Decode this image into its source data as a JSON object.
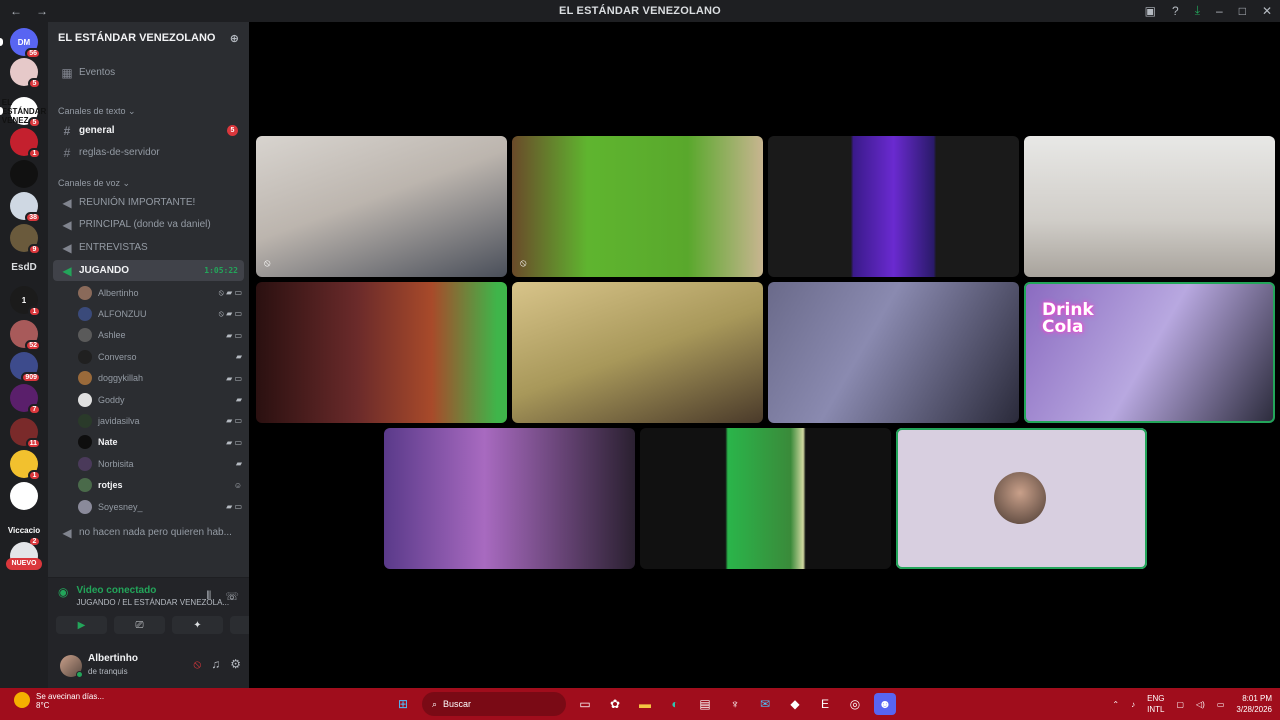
{
  "window": {
    "title": "EL ESTÁNDAR VENEZOLANO",
    "back": "←",
    "forward": "→"
  },
  "servers": {
    "items": [
      {
        "badge": "56",
        "color": "#5865f2",
        "label": "DM"
      },
      {
        "badge": "5",
        "color": "#e6c9c9",
        "label": ""
      },
      {
        "badge": "5",
        "color": "#ffffff",
        "label": "EL ESTÁNDAR VENEZ"
      },
      {
        "badge": "1",
        "color": "#c4202e",
        "label": ""
      },
      {
        "badge": "",
        "color": "#111111",
        "label": ""
      },
      {
        "badge": "38",
        "color": "#cfd8e3",
        "label": ""
      },
      {
        "badge": "9",
        "color": "#6a5a3c",
        "label": ""
      },
      {
        "badge": "1",
        "color": "#1b1b1b",
        "label": "1"
      },
      {
        "badge": "52",
        "color": "#a85a5a",
        "label": ""
      },
      {
        "badge": "909",
        "color": "#3d4b8c",
        "label": ""
      },
      {
        "badge": "7",
        "color": "#5a1f6b",
        "label": ""
      },
      {
        "badge": "11",
        "color": "#7a2a2a",
        "label": ""
      },
      {
        "badge": "1",
        "color": "#f2c12e",
        "label": ""
      },
      {
        "badge": "",
        "color": "#ffffff",
        "label": ""
      },
      {
        "badge": "2",
        "color": "#1e1f22",
        "label": "Viccacio"
      },
      {
        "badge": "",
        "color": "#e3e5e8",
        "label": ""
      }
    ],
    "text_item": "EsdD",
    "nuevo": "NUEVO"
  },
  "sidebar": {
    "server_name": "EL ESTÁNDAR VENEZOLANO",
    "events": "Eventos",
    "text_category": "Canales de texto",
    "text_channels": [
      {
        "name": "general",
        "badge": "5"
      },
      {
        "name": "reglas-de-servidor",
        "badge": ""
      }
    ],
    "voice_category": "Canales de voz",
    "voice_channels": [
      "REUNIÓN IMPORTANTE!",
      "PRINCIPAL (donde va daniel)",
      "ENTREVISTAS"
    ],
    "active_voice": {
      "name": "JUGANDO",
      "timer": "1:05:22"
    },
    "voice_users": [
      {
        "name": "Albertinho",
        "icons": "⦸ ▰ ▭",
        "bold": false,
        "color": "#8a6a5a"
      },
      {
        "name": "ALFONZUU",
        "icons": "⦸ ▰ ▭",
        "bold": false,
        "color": "#3a4a7a"
      },
      {
        "name": "Ashlee",
        "icons": "▰ ▭",
        "bold": false,
        "color": "#5a5a5a"
      },
      {
        "name": "Converso",
        "icons": "▰",
        "bold": false,
        "color": "#202020"
      },
      {
        "name": "doggykillah",
        "icons": "▰ ▭",
        "bold": false,
        "color": "#9a6a3a"
      },
      {
        "name": "Goddy",
        "icons": "▰",
        "bold": false,
        "color": "#e0e0e0"
      },
      {
        "name": "javidasilva",
        "icons": "▰ ▭",
        "bold": false,
        "color": "#2a3a2a"
      },
      {
        "name": "Nate",
        "icons": "▰ ▭",
        "bold": true,
        "color": "#0e0e0e"
      },
      {
        "name": "Norbisita",
        "icons": "▰",
        "bold": false,
        "color": "#4a3a5a"
      },
      {
        "name": "rotjes",
        "icons": "☺",
        "bold": true,
        "color": "#4a6a4a"
      },
      {
        "name": "Soyesney_",
        "icons": "▰ ▭",
        "bold": false,
        "color": "#8a8a9a"
      }
    ],
    "extra_channel": "no hacen nada pero quieren hab..."
  },
  "voice_panel": {
    "status": "Video conectado",
    "location": "JUGANDO / EL ESTÁNDAR VENEZOLA...",
    "buttons": [
      "▶",
      "⎚",
      "✦",
      "✧"
    ]
  },
  "user_panel": {
    "name": "Albertinho",
    "status": "de tranquis",
    "mute_icon": "⦸",
    "headset_icon": "♫",
    "settings_icon": "⚙"
  },
  "stage": {
    "tiles": [
      {
        "name": "tile-1",
        "bg": "linear-gradient(160deg,#d8d4cf 0%,#bcb5ae 45%,#4a4f5a 100%)",
        "muted": true
      },
      {
        "name": "tile-2",
        "bg": "linear-gradient(90deg,#6a4a2a 0%,#5fb52f 30%,#59a82c 70%,#c8b590 100%)",
        "muted": true
      },
      {
        "name": "tile-3",
        "bg": "linear-gradient(90deg,#1a1a1a 0%,#1a1a1a 33%,#3a1a8a 34%,#6a2ad0 50%,#2a1a6a 66%,#1a1a1a 67%,#1a1a1a 100%)",
        "muted": false
      },
      {
        "name": "tile-4",
        "bg": "linear-gradient(180deg,#e8e8e6 0%,#d0cdc8 60%,#a8a39c 100%)",
        "muted": false
      },
      {
        "name": "tile-5",
        "bg": "linear-gradient(90deg,#2a1010 0%,#6a2a2a 40%,#a84a2a 70%,#3fb54a 96%,#3fb54a 100%)",
        "muted": false
      },
      {
        "name": "tile-6",
        "bg": "linear-gradient(160deg,#d8c48a 0%,#a8985a 50%,#4a3a2a 100%)",
        "muted": false
      },
      {
        "name": "tile-7",
        "bg": "linear-gradient(120deg,#6a6a8a 0%,#8a8ab0 40%,#2a2a3a 100%)",
        "muted": false
      },
      {
        "name": "tile-8",
        "bg": "linear-gradient(120deg,#8a6ac0 0%,#b8a8e0 50%,#2a2a3a 100%)",
        "muted": false
      },
      {
        "name": "tile-9",
        "bg": "linear-gradient(90deg,#5a3a8a 0%,#a86ac0 40%,#2a2030 100%)",
        "muted": false
      },
      {
        "name": "tile-10",
        "bg": "linear-gradient(90deg,#111 0%,#111 34%,#2ab54a 35%,#3a8a3a 60%,#d0d8a0 65%,#111 66%,#111 100%)",
        "muted": false
      },
      {
        "name": "tile-11",
        "bg": "#d8cfe0",
        "muted": false
      }
    ],
    "overlay_text": "Drink Cola",
    "muted_icon": "⦸"
  },
  "taskbar": {
    "weather_line1": "Se avecinan días...",
    "weather_line2": "8°C",
    "search": "Buscar",
    "lang1": "ENG",
    "lang2": "INTL",
    "time": "8:01 PM",
    "date": "3/28/2026"
  }
}
